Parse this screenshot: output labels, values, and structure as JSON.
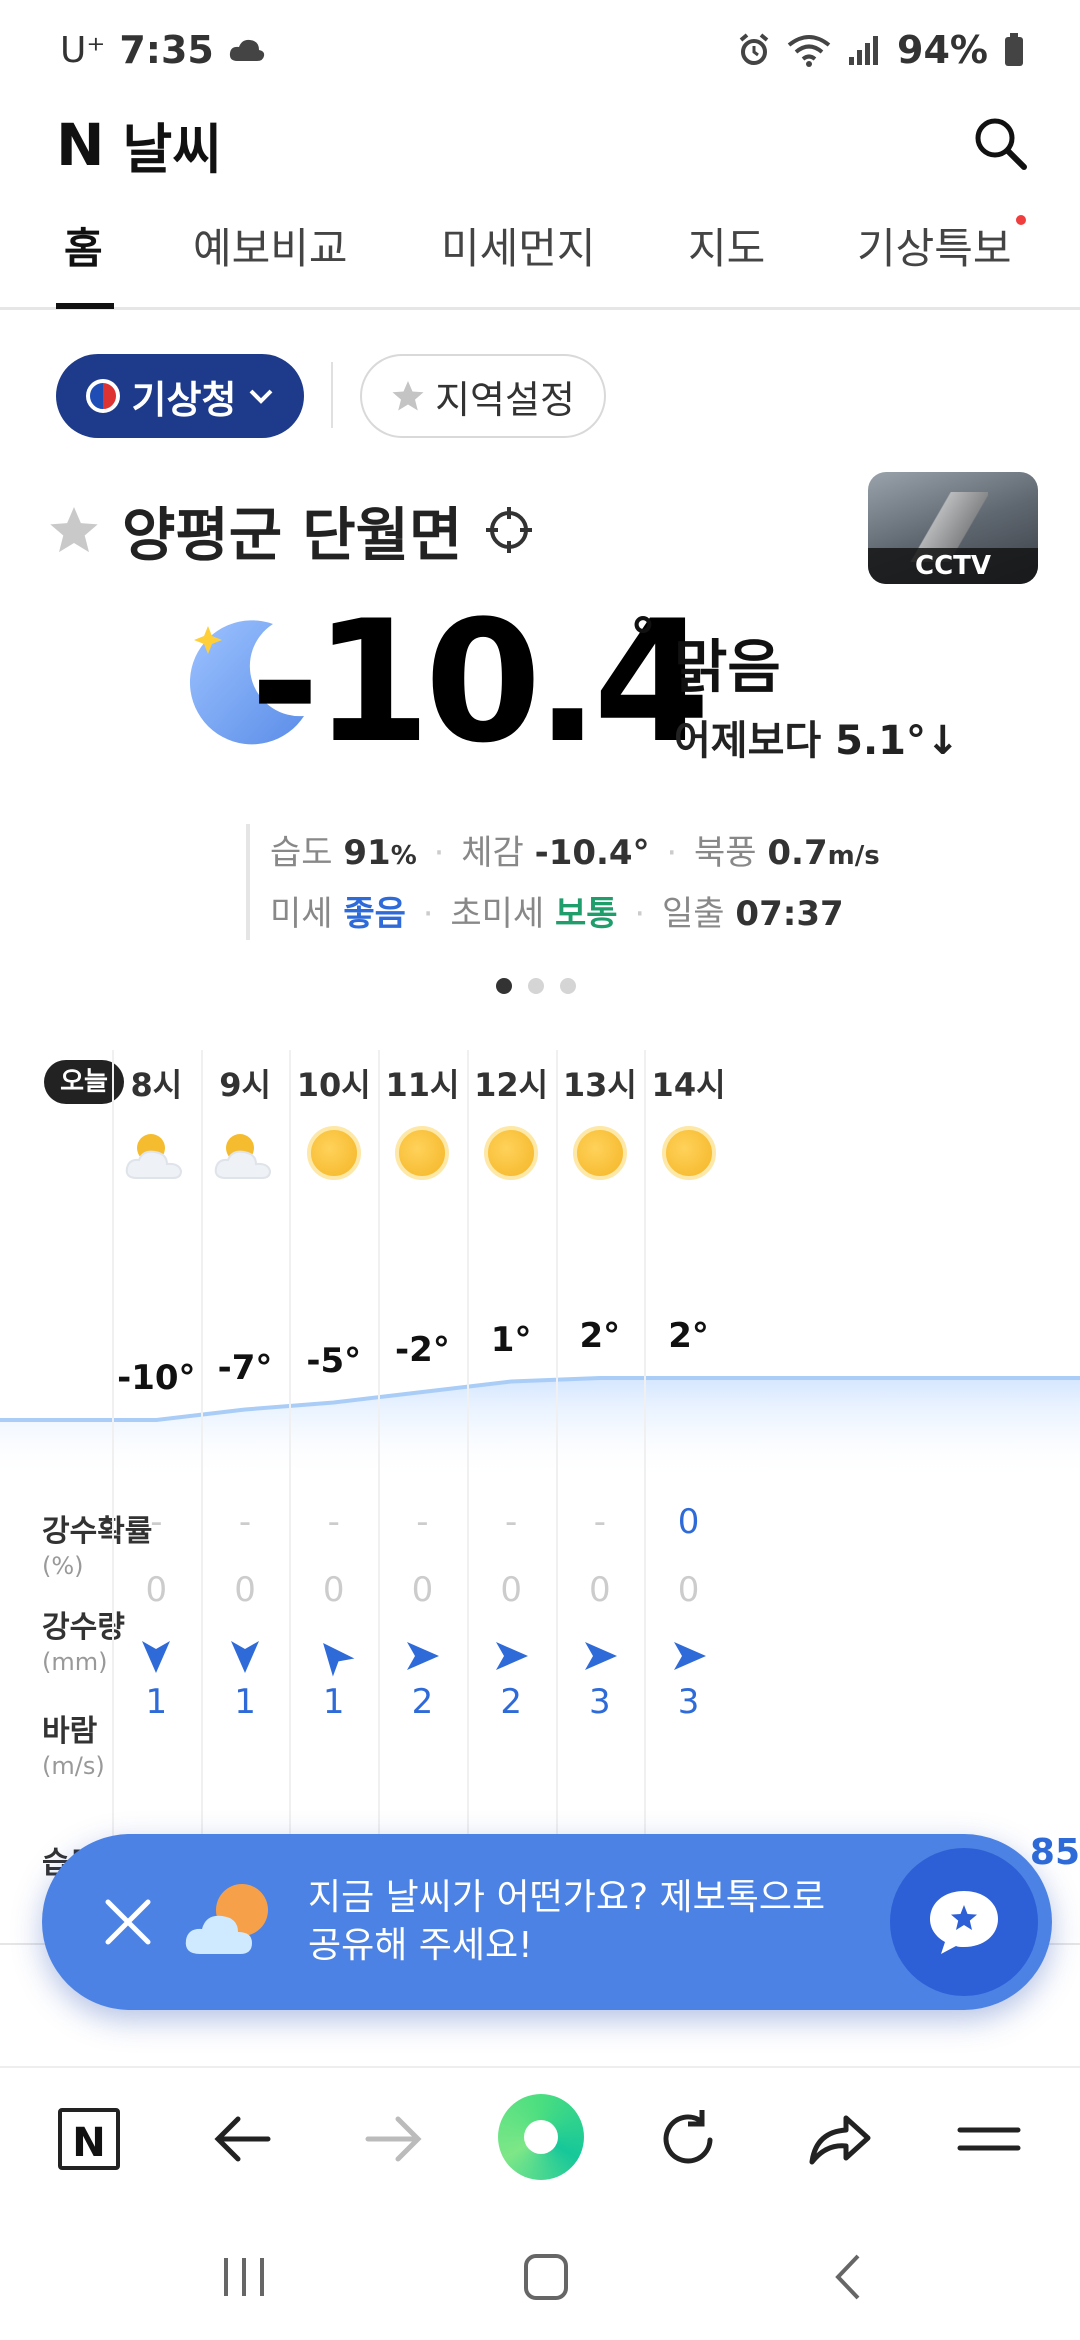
{
  "status": {
    "carrier": "U⁺",
    "time": "7:35",
    "battery": "94%"
  },
  "header": {
    "logo": "N",
    "title": "날씨"
  },
  "tabs": [
    {
      "label": "홈"
    },
    {
      "label": "예보비교"
    },
    {
      "label": "미세먼지"
    },
    {
      "label": "지도"
    },
    {
      "label": "기상특보"
    }
  ],
  "source": {
    "selected": "기상청",
    "region_btn": "지역설정"
  },
  "location": {
    "name": "양평군 단월면",
    "cctv_label": "CCTV"
  },
  "current": {
    "temp": "-10.4",
    "deg": "°",
    "condition": "맑음",
    "compare": "어제보다 5.1°↓"
  },
  "details": {
    "humidity_label": "습도",
    "humidity": "91",
    "humidity_unit": "%",
    "feels_label": "체감",
    "feels": "-10.4°",
    "wind_label": "북풍",
    "wind": "0.7",
    "wind_unit": "m/s",
    "dust_label": "미세",
    "dust": "좋음",
    "fine_label": "초미세",
    "fine": "보통",
    "sunrise_label": "일출",
    "sunrise": "07:37"
  },
  "hourly": {
    "today": "오늘",
    "hours": [
      "8시",
      "9시",
      "10시",
      "11시",
      "12시",
      "13시",
      "14시"
    ],
    "icons": [
      "partly-cloudy-icon",
      "partly-cloudy-icon",
      "sun-icon",
      "sun-icon",
      "sun-icon",
      "sun-icon",
      "sun-icon"
    ],
    "temps": [
      "-10°",
      "-7°",
      "-5°",
      "-2°",
      "1°",
      "2°",
      "2°"
    ],
    "temp_values": [
      -10,
      -7,
      -5,
      -2,
      1,
      2,
      2
    ],
    "precip_prob_label": "강수확률",
    "precip_prob_unit": "(%)",
    "precip_prob": [
      "-",
      "-",
      "-",
      "-",
      "-",
      "-",
      "0"
    ],
    "precip_amt_label": "강수량",
    "precip_amt_unit": "(mm)",
    "precip_amt": [
      "0",
      "0",
      "0",
      "0",
      "0",
      "0",
      "0"
    ],
    "wind_label": "바람",
    "wind_unit": "(m/s)",
    "wind_dirs": [
      "down",
      "down",
      "up-left",
      "right",
      "right",
      "right",
      "right"
    ],
    "wind": [
      "1",
      "1",
      "1",
      "2",
      "2",
      "3",
      "3"
    ],
    "humidity_label_partial": "습도",
    "humidity_last_partial": "85"
  },
  "banner": {
    "text": "지금 날씨가 어떤가요? 제보톡으로 공유해 주세요!"
  },
  "colors": {
    "accent": "#4c82e3",
    "source_btn": "#1e3a8a",
    "good": "#2f6bd8",
    "normal": "#1f9d6b"
  }
}
